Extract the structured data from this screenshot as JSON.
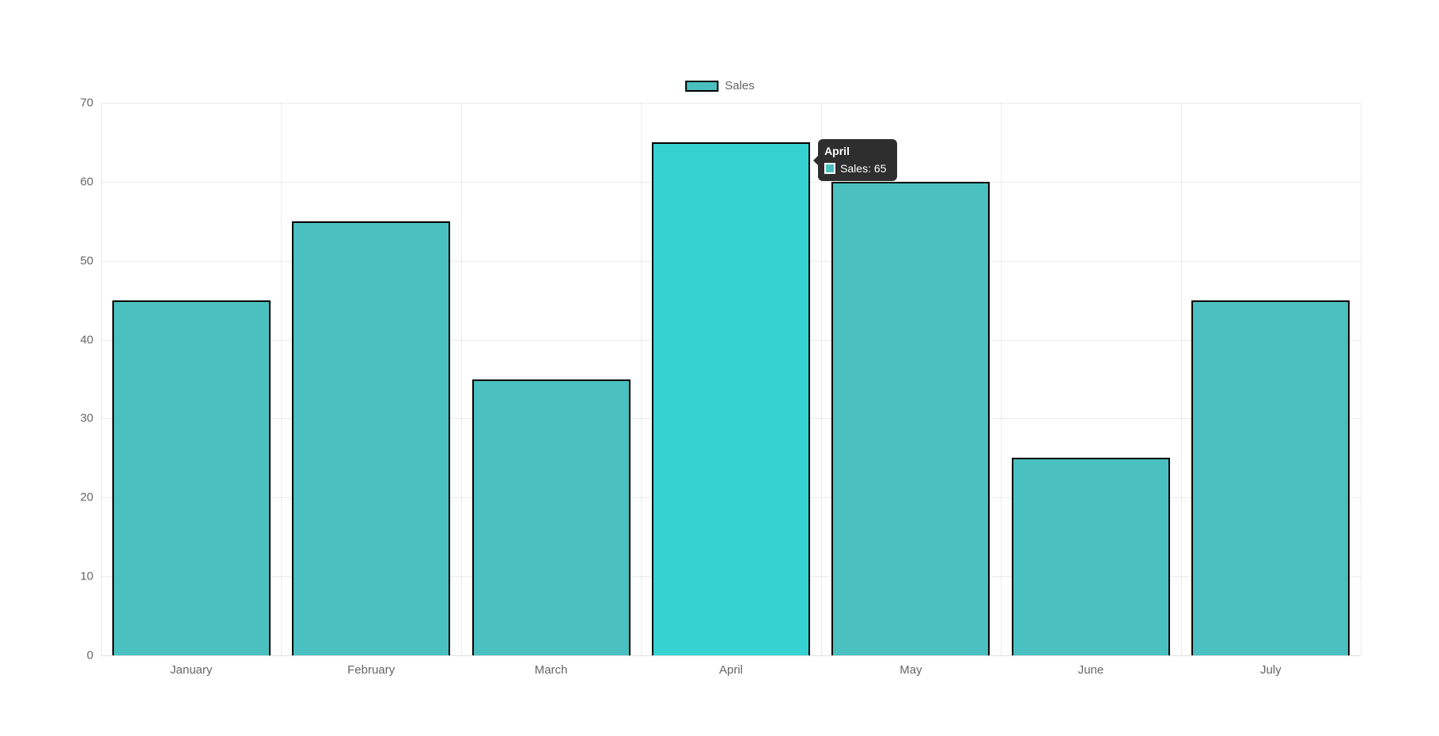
{
  "chart_data": {
    "type": "bar",
    "categories": [
      "January",
      "February",
      "March",
      "April",
      "May",
      "June",
      "July"
    ],
    "series": [
      {
        "name": "Sales",
        "values": [
          45,
          55,
          35,
          65,
          60,
          25,
          45
        ]
      }
    ],
    "ylim": [
      0,
      70
    ],
    "yticks": [
      0,
      10,
      20,
      30,
      40,
      50,
      60,
      70
    ],
    "bar_color": "#4bc0c0",
    "bar_color_hover": "#36d1d1",
    "border_color": "#000000"
  },
  "legend": {
    "label": "Sales"
  },
  "tooltip": {
    "visible": true,
    "index": 3,
    "title": "April",
    "series_label": "Sales",
    "value": 65,
    "body_text": "Sales: 65"
  }
}
